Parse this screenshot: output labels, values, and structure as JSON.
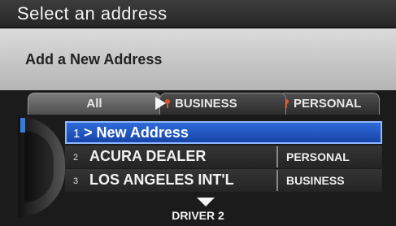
{
  "header": {
    "title": "Select an address"
  },
  "prompt": {
    "text": "Add a New Address"
  },
  "tabs": [
    {
      "label": "All",
      "active": true
    },
    {
      "label": "BUSINESS",
      "icon": "pin-icon"
    },
    {
      "label": "PERSONAL",
      "icon": "pin-icon"
    }
  ],
  "list": {
    "items": [
      {
        "number": "1",
        "label": "> New Address",
        "category": "",
        "selected": true
      },
      {
        "number": "2",
        "label": "ACURA DEALER",
        "category": "PERSONAL"
      },
      {
        "number": "3",
        "label": "LOS ANGELES INT'L",
        "category": "BUSINESS"
      }
    ]
  },
  "footer": {
    "driver": "DRIVER 2"
  },
  "colors": {
    "highlight": "#2f6bd8",
    "pin": "#e5532a"
  }
}
